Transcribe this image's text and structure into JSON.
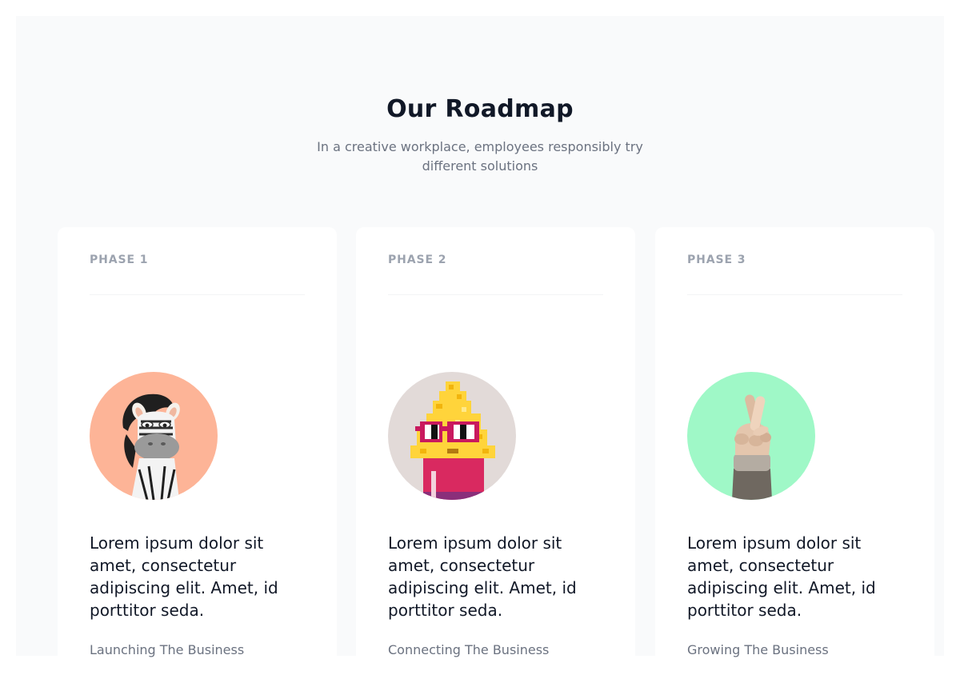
{
  "roadmap": {
    "title": "Our Roadmap",
    "subtitle": "In a creative workplace, employees responsibly try different solutions",
    "phases": [
      {
        "label": "PHASE 1",
        "avatar_icon": "zebra-avatar-icon",
        "avatar_bg": "#fdb497",
        "description": "Lorem ipsum dolor sit amet, consectetur adipiscing elit. Amet, id porttitor seda.",
        "caption": "Launching The Business"
      },
      {
        "label": "PHASE 2",
        "avatar_icon": "pixel-character-avatar-icon",
        "avatar_bg": "#e2dad8",
        "description": "Lorem ipsum dolor sit amet, consectetur adipiscing elit. Amet, id porttitor seda.",
        "caption": "Connecting The Business"
      },
      {
        "label": "PHASE 3",
        "avatar_icon": "crossed-fingers-avatar-icon",
        "avatar_bg": "#9ff8c7",
        "description": "Lorem ipsum dolor sit amet, consectetur adipiscing elit. Amet, id porttitor seda.",
        "caption": "Growing The Business"
      }
    ]
  }
}
